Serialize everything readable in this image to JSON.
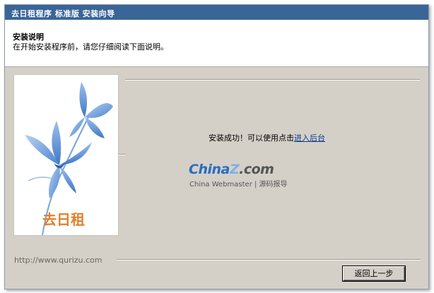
{
  "window": {
    "title": "去日租程序 标准版 安装向导"
  },
  "header": {
    "title": "安装说明",
    "subtitle": "在开始安装程序前，请您仔细阅读下面说明。"
  },
  "side_image": {
    "logo_text": "去日租"
  },
  "main": {
    "message": "安装成功！可以使用点击",
    "link": "进入后台"
  },
  "watermark": {
    "brand": "China",
    "brand_z": "Z",
    "brand_suffix": ".com",
    "tagline": "China Webmaster | 源码报导"
  },
  "footer": {
    "url": "http://www.qurizu.com",
    "back_button": "返回上一步"
  },
  "colors": {
    "titlebar": "#3a6597",
    "panel": "#d4d0c8",
    "link": "#0b3a8c",
    "flower": "#5b8fd6",
    "logo": "#e0802a"
  }
}
